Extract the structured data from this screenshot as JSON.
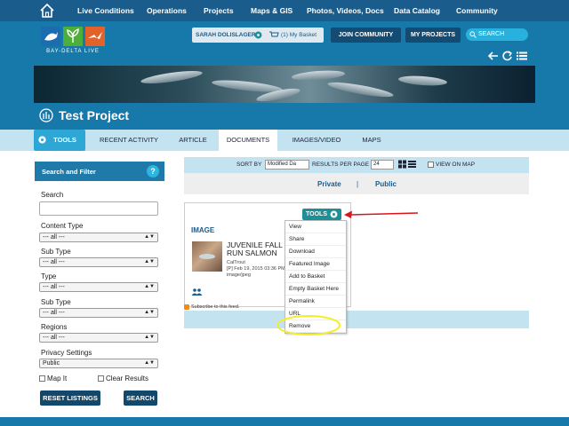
{
  "topnav": {
    "items": [
      "Live Conditions",
      "Operations",
      "Projects",
      "Maps & GIS",
      "Photos, Videos, Docs",
      "Data Catalog",
      "Community"
    ]
  },
  "header": {
    "logo_text": "BAY-DELTA LIVE",
    "user_name": "SARAH DOLISLAGER",
    "basket_label": "(1) My Basket",
    "join_label": "JOIN COMMUNITY",
    "projects_label": "MY PROJECTS",
    "search_placeholder": "SEARCH"
  },
  "project": {
    "title": "Test Project"
  },
  "tabs": [
    "TOOLS",
    "RECENT ACTIVITY",
    "ARTICLE",
    "DOCUMENTS",
    "IMAGES/VIDEO",
    "MAPS"
  ],
  "active_tab": "DOCUMENTS",
  "sidebar": {
    "title": "Search and Filter",
    "help": "?",
    "search_label": "Search",
    "filters": [
      {
        "label": "Content Type",
        "value": "--- all ---"
      },
      {
        "label": "Sub Type",
        "value": "--- all ---"
      },
      {
        "label": "Type",
        "value": "--- all ---"
      },
      {
        "label": "Sub Type",
        "value": "--- all ---"
      },
      {
        "label": "Regions",
        "value": "--- all ---"
      },
      {
        "label": "Privacy Settings",
        "value": "Public"
      }
    ],
    "map_it": "Map It",
    "clear_results": "Clear Results",
    "reset_label": "RESET LISTINGS",
    "search_button": "SEARCH"
  },
  "sort_bar": {
    "sort_by": "SORT BY",
    "sort_value": "Modified Da",
    "per_page_label": "RESULTS PER PAGE",
    "per_page_value": "24",
    "view_on_map": "VIEW ON MAP"
  },
  "visibility": {
    "private": "Private",
    "separator": "|",
    "public": "Public"
  },
  "card": {
    "tools_label": "TOOLS",
    "type": "IMAGE",
    "title": "JUVENILE FALL RUN SALMON",
    "author": "CalTrout",
    "date": "[P] Feb 19, 2015 03:36 PM",
    "mime": "image/jpeg",
    "subscribe": "Subscribe to this feed."
  },
  "menu": [
    "View",
    "Share",
    "Download",
    "Featured Image",
    "Add to Basket",
    "Empty Basket Here",
    "Permalink",
    "URL",
    "Remove"
  ],
  "colors": {
    "primary": "#1779a9",
    "nav": "#1a5c8c",
    "accent": "#2fa7d6",
    "tools_teal": "#1d8f97",
    "annotation_red": "#d9141b",
    "annotation_yellow": "#f5ec2a"
  }
}
